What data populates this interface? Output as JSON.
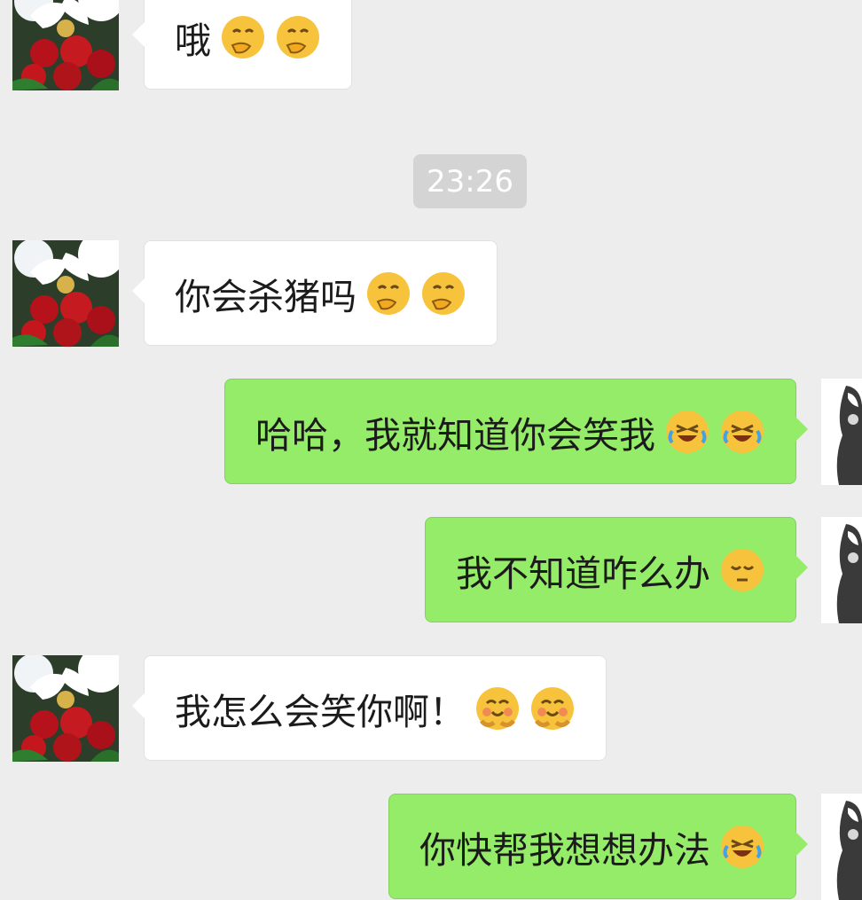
{
  "timestamp": "23:26",
  "messages": [
    {
      "side": "left",
      "text": "哦",
      "emojis": [
        "smirk-hand",
        "smirk-hand"
      ]
    },
    {
      "side": "left",
      "text": "你会杀猪吗",
      "emojis": [
        "smirk-hand",
        "smirk-hand"
      ]
    },
    {
      "side": "right",
      "text": "哈哈，我就知道你会笑我",
      "emojis": [
        "laugh-cry",
        "laugh-cry"
      ]
    },
    {
      "side": "right",
      "text": "我不知道咋么办",
      "emojis": [
        "pensive"
      ]
    },
    {
      "side": "left",
      "text": "我怎么会笑你啊！",
      "emojis": [
        "hug-face",
        "hug-face"
      ]
    },
    {
      "side": "right",
      "text": "你快帮我想想办法",
      "emojis": [
        "laugh-cry"
      ]
    }
  ]
}
